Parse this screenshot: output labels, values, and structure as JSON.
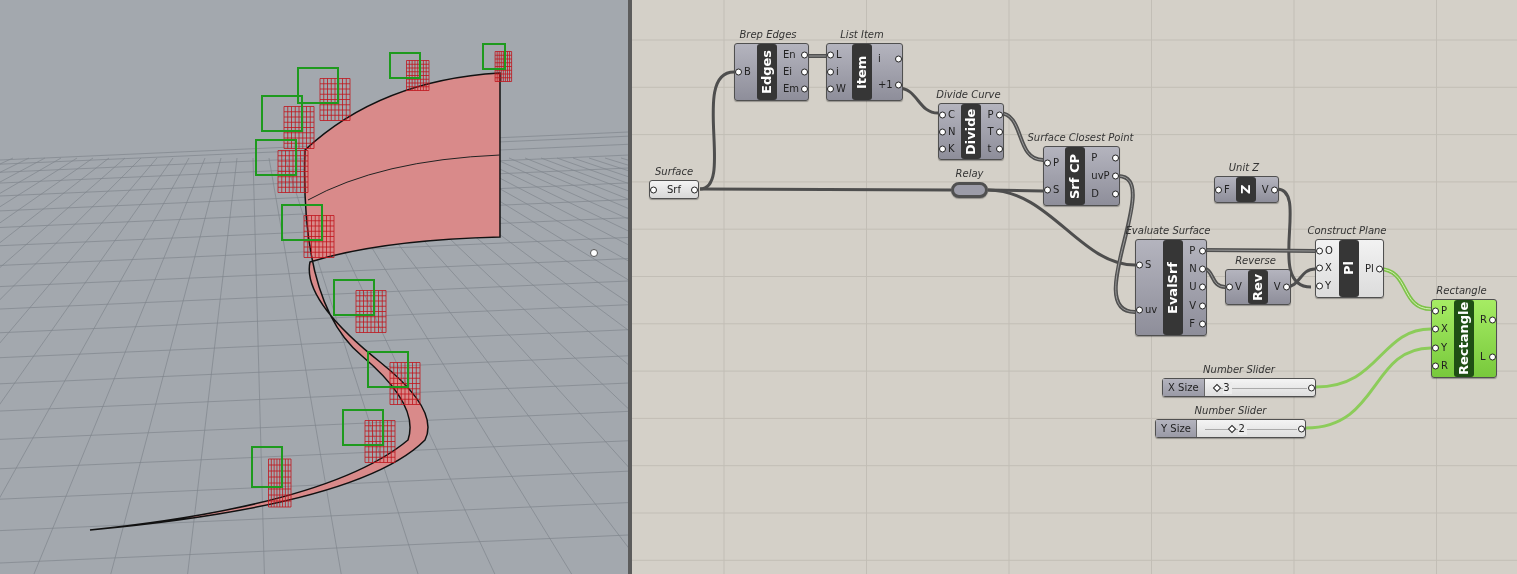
{
  "canvas": {
    "nodes": [
      {
        "kind": "param",
        "title": "Surface",
        "name": "Srf",
        "selected": false,
        "highlighted": false
      },
      {
        "kind": "component",
        "title": "Brep Edges",
        "name": "Edges",
        "inputs": [
          "B"
        ],
        "outputs": [
          "En",
          "Ei",
          "Em"
        ],
        "selected": false,
        "highlighted": false
      },
      {
        "kind": "component",
        "title": "List Item",
        "name": "Item",
        "inputs": [
          "L",
          "i",
          "W"
        ],
        "outputs": [
          "i",
          "+1"
        ],
        "selected": false,
        "highlighted": false
      },
      {
        "kind": "component",
        "title": "Divide Curve",
        "name": "Divide",
        "inputs": [
          "C",
          "N",
          "K"
        ],
        "outputs": [
          "P",
          "T",
          "t"
        ],
        "selected": false,
        "highlighted": false
      },
      {
        "kind": "component",
        "title": "Surface Closest Point",
        "name": "Srf CP",
        "inputs": [
          "P",
          "S"
        ],
        "outputs": [
          "P",
          "uvP",
          "D"
        ],
        "selected": false,
        "highlighted": false
      },
      {
        "kind": "relay",
        "title": "Relay",
        "selected": false,
        "highlighted": false
      },
      {
        "kind": "component",
        "title": "Unit Z",
        "name": "Z",
        "inputs": [
          "F"
        ],
        "outputs": [
          "V"
        ],
        "selected": false,
        "highlighted": false
      },
      {
        "kind": "component",
        "title": "Evaluate Surface",
        "name": "EvalSrf",
        "inputs": [
          "S",
          "uv"
        ],
        "outputs": [
          "P",
          "N",
          "U",
          "V",
          "F"
        ],
        "selected": false,
        "highlighted": false
      },
      {
        "kind": "component",
        "title": "Reverse",
        "name": "Rev",
        "inputs": [
          "V"
        ],
        "outputs": [
          "V"
        ],
        "selected": false,
        "highlighted": false
      },
      {
        "kind": "component",
        "title": "Construct Plane",
        "name": "Pl",
        "inputs": [
          "O",
          "X",
          "Y"
        ],
        "outputs": [
          "Pl"
        ],
        "selected": false,
        "highlighted": true
      },
      {
        "kind": "component",
        "title": "Rectangle",
        "name": "Rectangle",
        "inputs": [
          "P",
          "X",
          "Y",
          "R"
        ],
        "outputs": [
          "R",
          "L"
        ],
        "selected": true,
        "highlighted": false
      },
      {
        "kind": "slider",
        "title": "Number Slider",
        "label": "X Size",
        "value": "3",
        "level": 0.05
      },
      {
        "kind": "slider",
        "title": "Number Slider",
        "label": "Y Size",
        "value": "2",
        "level": 0.3
      }
    ]
  }
}
